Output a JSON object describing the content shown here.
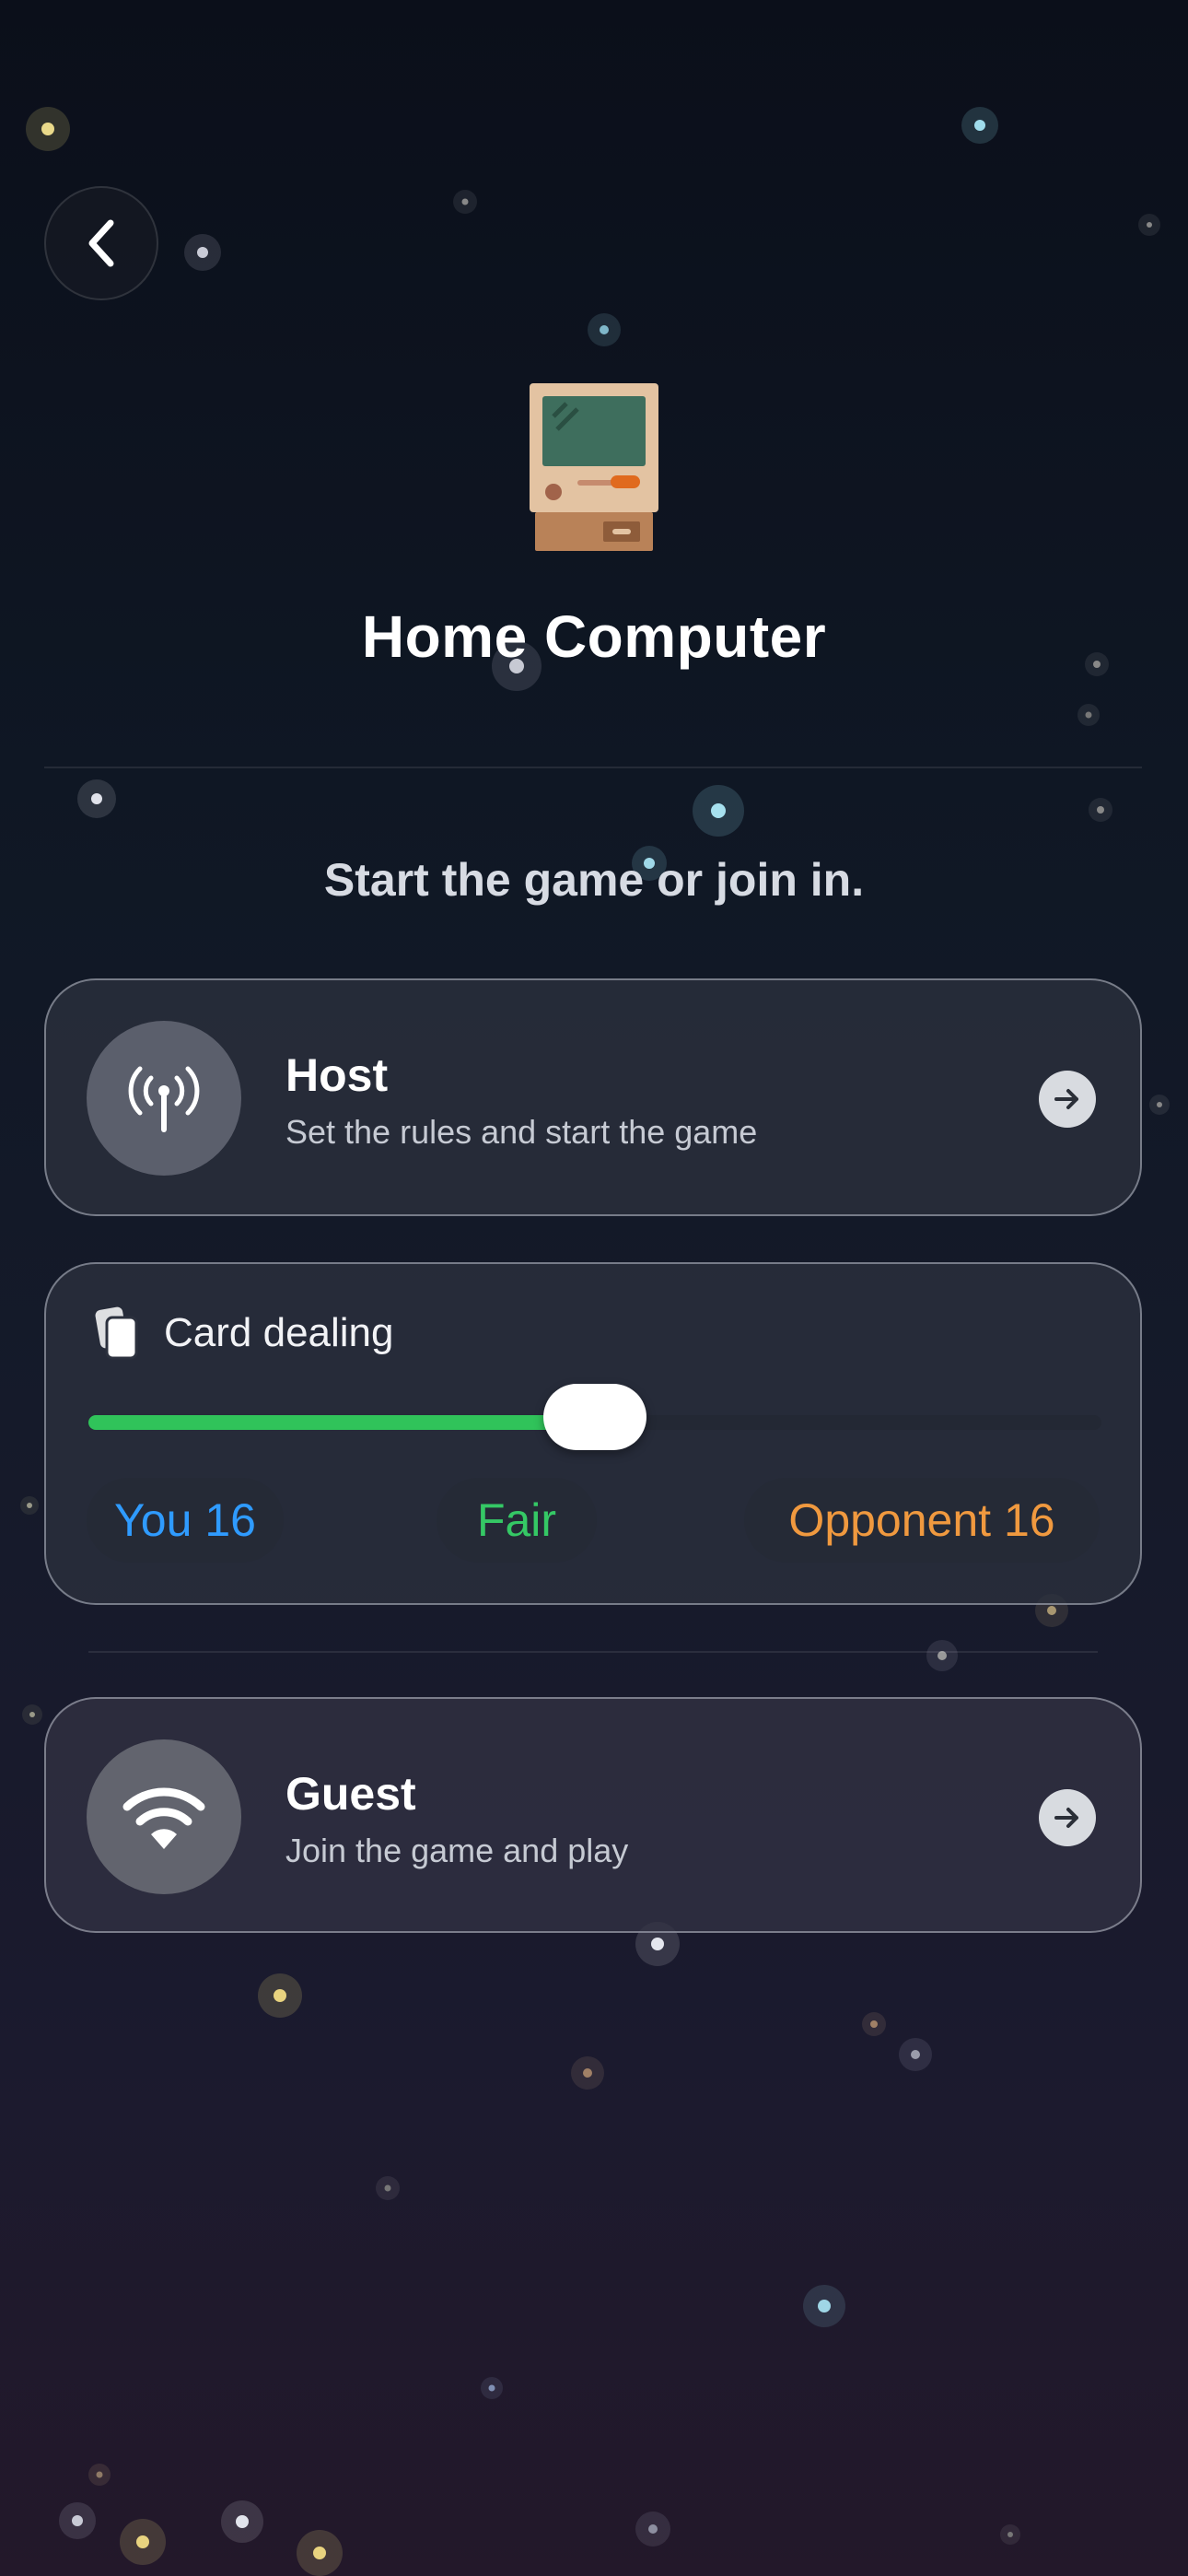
{
  "header": {
    "title": "Home Computer",
    "back_icon": "chevron-left-icon",
    "app_icon": "retro-computer-icon"
  },
  "prompt": "Start the game or join in.",
  "host_option": {
    "title": "Host",
    "description": "Set the rules and start the game",
    "icon": "antenna-broadcast-icon",
    "action_icon": "arrow-right-icon"
  },
  "card_dealing": {
    "label": "Card dealing",
    "icon": "cards-icon",
    "slider_value": 0.5,
    "you_label": "You 16",
    "fair_label": "Fair",
    "opponent_label": "Opponent 16",
    "colors": {
      "you": "#2f9bff",
      "fair": "#35c865",
      "opponent": "#f0993f",
      "track_fill": "#30c35a"
    }
  },
  "guest_option": {
    "title": "Guest",
    "description": "Join the game and play",
    "icon": "wifi-icon",
    "action_icon": "arrow-right-icon"
  }
}
